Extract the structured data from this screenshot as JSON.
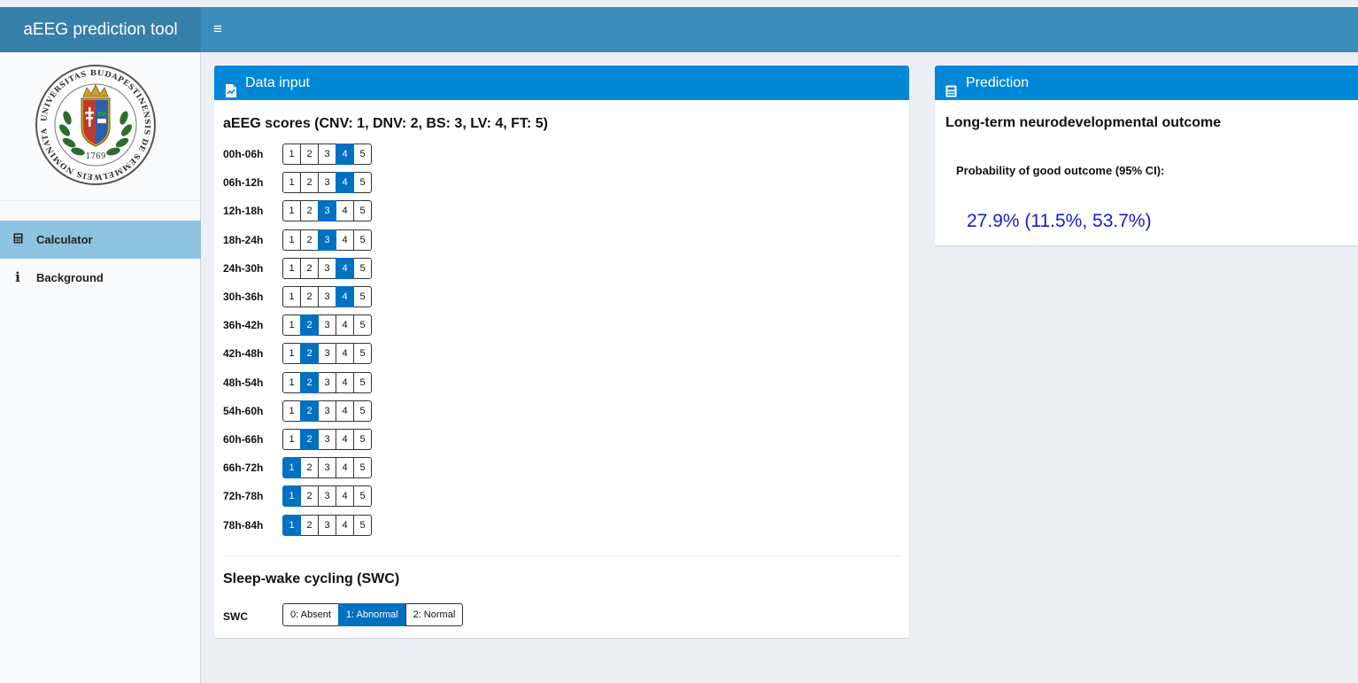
{
  "header": {
    "brand": "aEEG prediction tool",
    "menu_toggle_glyph": "≡"
  },
  "sidebar": {
    "logo": {
      "ring_text": "UNIVERSITAS BUDAPESTINENSIS DE SEMMELWEIS NOMINATA",
      "year": "1769"
    },
    "items": [
      {
        "label": "Calculator",
        "icon": "calculator-icon",
        "active": true
      },
      {
        "label": "Background",
        "icon": "info-icon",
        "active": false
      }
    ]
  },
  "data_input": {
    "title": "Data input",
    "icon": "file-chart-icon",
    "scores_title": "aEEG scores (CNV: 1, DNV: 2, BS: 3, LV: 4, FT: 5)",
    "options": [
      "1",
      "2",
      "3",
      "4",
      "5"
    ],
    "rows": [
      {
        "label": "00h-06h",
        "selected": 4
      },
      {
        "label": "06h-12h",
        "selected": 4
      },
      {
        "label": "12h-18h",
        "selected": 3
      },
      {
        "label": "18h-24h",
        "selected": 3
      },
      {
        "label": "24h-30h",
        "selected": 4
      },
      {
        "label": "30h-36h",
        "selected": 4
      },
      {
        "label": "36h-42h",
        "selected": 2
      },
      {
        "label": "42h-48h",
        "selected": 2
      },
      {
        "label": "48h-54h",
        "selected": 2
      },
      {
        "label": "54h-60h",
        "selected": 2
      },
      {
        "label": "60h-66h",
        "selected": 2
      },
      {
        "label": "66h-72h",
        "selected": 1
      },
      {
        "label": "72h-78h",
        "selected": 1
      },
      {
        "label": "78h-84h",
        "selected": 1
      }
    ],
    "swc": {
      "title": "Sleep-wake cycling (SWC)",
      "label": "SWC",
      "options": [
        "0: Absent",
        "1: Abnormal",
        "2: Normal"
      ],
      "selected": 1
    }
  },
  "prediction": {
    "title": "Prediction",
    "icon": "calculator-icon",
    "outcome_title": "Long-term neurodevelopmental outcome",
    "prob_label": "Probability of good outcome (95% CI):",
    "prob_value": "27.9% (11.5%, 53.7%)"
  },
  "colors": {
    "topbar": "#3c8dbc",
    "brand_bg": "#367fa9",
    "box_header": "#0088d6",
    "selected": "#0070c0",
    "active_nav": "#8ec3e1",
    "result_text": "#1a1acc"
  }
}
